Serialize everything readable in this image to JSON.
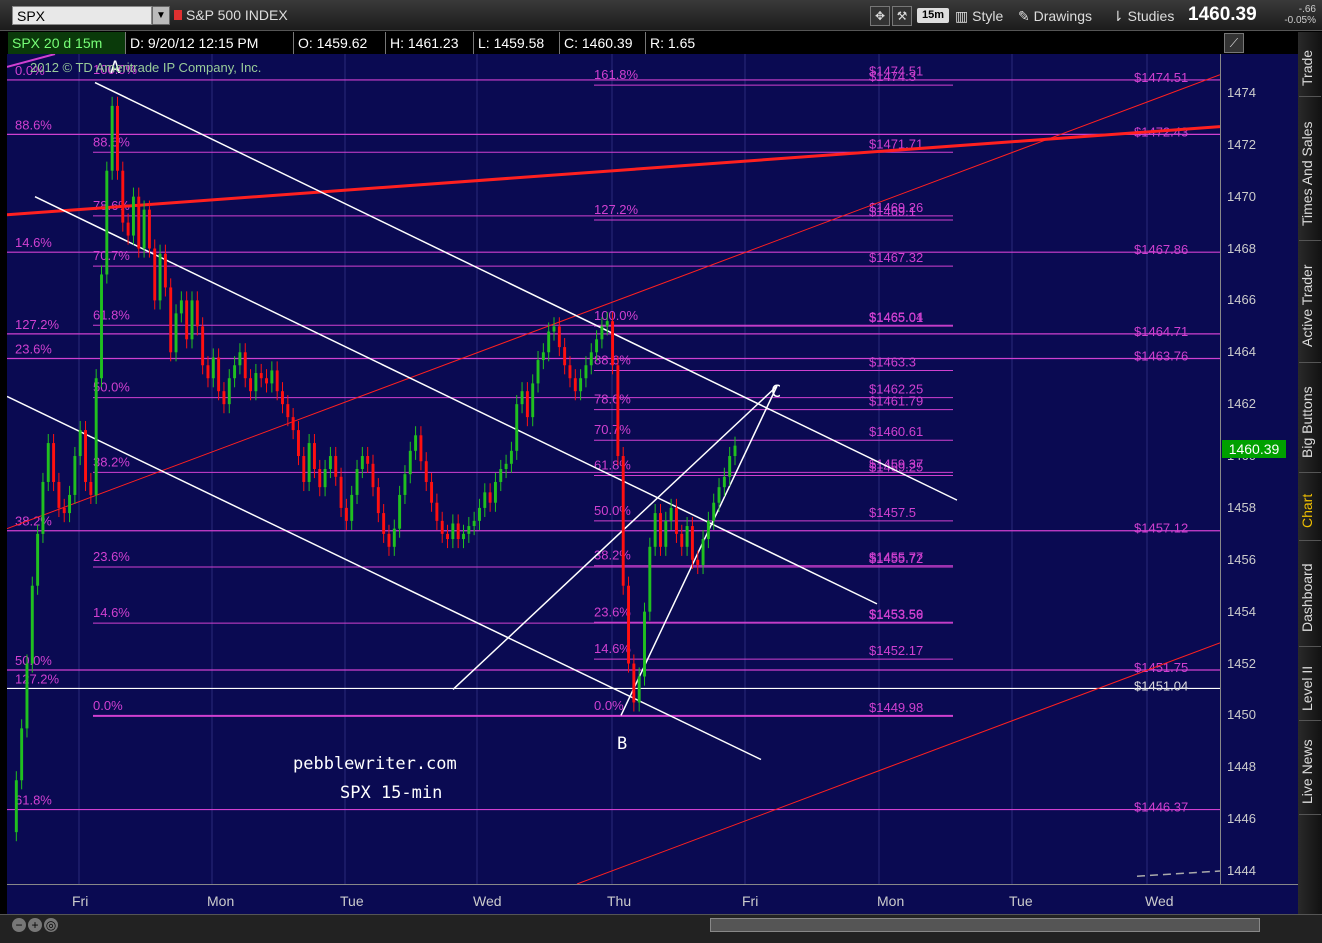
{
  "toolbar": {
    "symbol": "SPX",
    "symbol_name": "S&P 500 INDEX",
    "timeframe_badge": "15m",
    "style_label": "Style",
    "drawings_label": "Drawings",
    "studies_label": "Studies",
    "last_price": "1460.39",
    "change": "-.66",
    "change_pct": "-0.05%"
  },
  "info_bar": {
    "series": "SPX 20 d 15m",
    "date": "D: 9/20/12 12:15 PM",
    "open": "O: 1459.62",
    "high": "H: 1461.23",
    "low": "L: 1459.58",
    "close": "C: 1460.39",
    "range": "R: 1.65"
  },
  "copyright": "2012 © TD Ameritrade IP Company, Inc.",
  "sidebar_tabs": [
    "Trade",
    "Times And Sales",
    "Active Trader",
    "Big Buttons",
    "Chart",
    "Dashboard",
    "Level II",
    "Live News"
  ],
  "active_tab": "Chart",
  "annotations": {
    "site": "pebblewriter.com",
    "subtitle": "SPX 15-min",
    "point_a": "A",
    "point_b": "B",
    "point_c": "C"
  },
  "chart_data": {
    "type": "candlestick",
    "ylim": [
      1443.5,
      1475.5
    ],
    "y_ticks": [
      1444,
      1446,
      1448,
      1450,
      1452,
      1454,
      1456,
      1458,
      1460,
      1462,
      1464,
      1466,
      1468,
      1470,
      1472,
      1474
    ],
    "x_day_labels": [
      "Fri",
      "Mon",
      "Tue",
      "Wed",
      "Thu",
      "Fri",
      "Mon",
      "Tue",
      "Wed"
    ],
    "current_price_label": "1460.39",
    "price_labels_right": [
      "$1474.51",
      "$1472.43",
      "$1467.86",
      "$1464.71",
      "$1463.76",
      "$1457.12",
      "$1451.75",
      "$1451.04",
      "$1446.37"
    ],
    "price_labels_mid": [
      "$1474.51",
      "$1474.3",
      "$1471.71",
      "$1469.26",
      "$1469.1",
      "$1467.32",
      "$1465.04",
      "$1465.01",
      "$1463.3",
      "$1462.25",
      "$1461.79",
      "$1460.61",
      "$1459.37",
      "$1459.25",
      "$1457.5",
      "$1455.77",
      "$1455.72",
      "$1453.56",
      "$1453.59",
      "$1452.17",
      "$1449.98"
    ],
    "fib_left": [
      "0.0%",
      "88.6%",
      "14.6%",
      "127.2%",
      "23.6%",
      "38.2%",
      "50.0%",
      "127.2%",
      "61.8%"
    ],
    "fib_set2": [
      "100.0%",
      "88.6%",
      "78.6%",
      "70.7%",
      "61.8%",
      "50.0%",
      "38.2%",
      "23.6%",
      "14.6%",
      "0.0%"
    ],
    "fib_set3": [
      "161.8%",
      "127.2%",
      "100.0%",
      "88.6%",
      "78.6%",
      "70.7%",
      "61.8%",
      "50.0%",
      "38.2%",
      "23.6%",
      "14.6%",
      "0.0%"
    ],
    "colors": {
      "background": "#0a0a52",
      "fib": "#d040d0",
      "up": "#20c020",
      "down": "#ff1010",
      "trend": "#ff2020",
      "channel": "#ffffff"
    }
  }
}
